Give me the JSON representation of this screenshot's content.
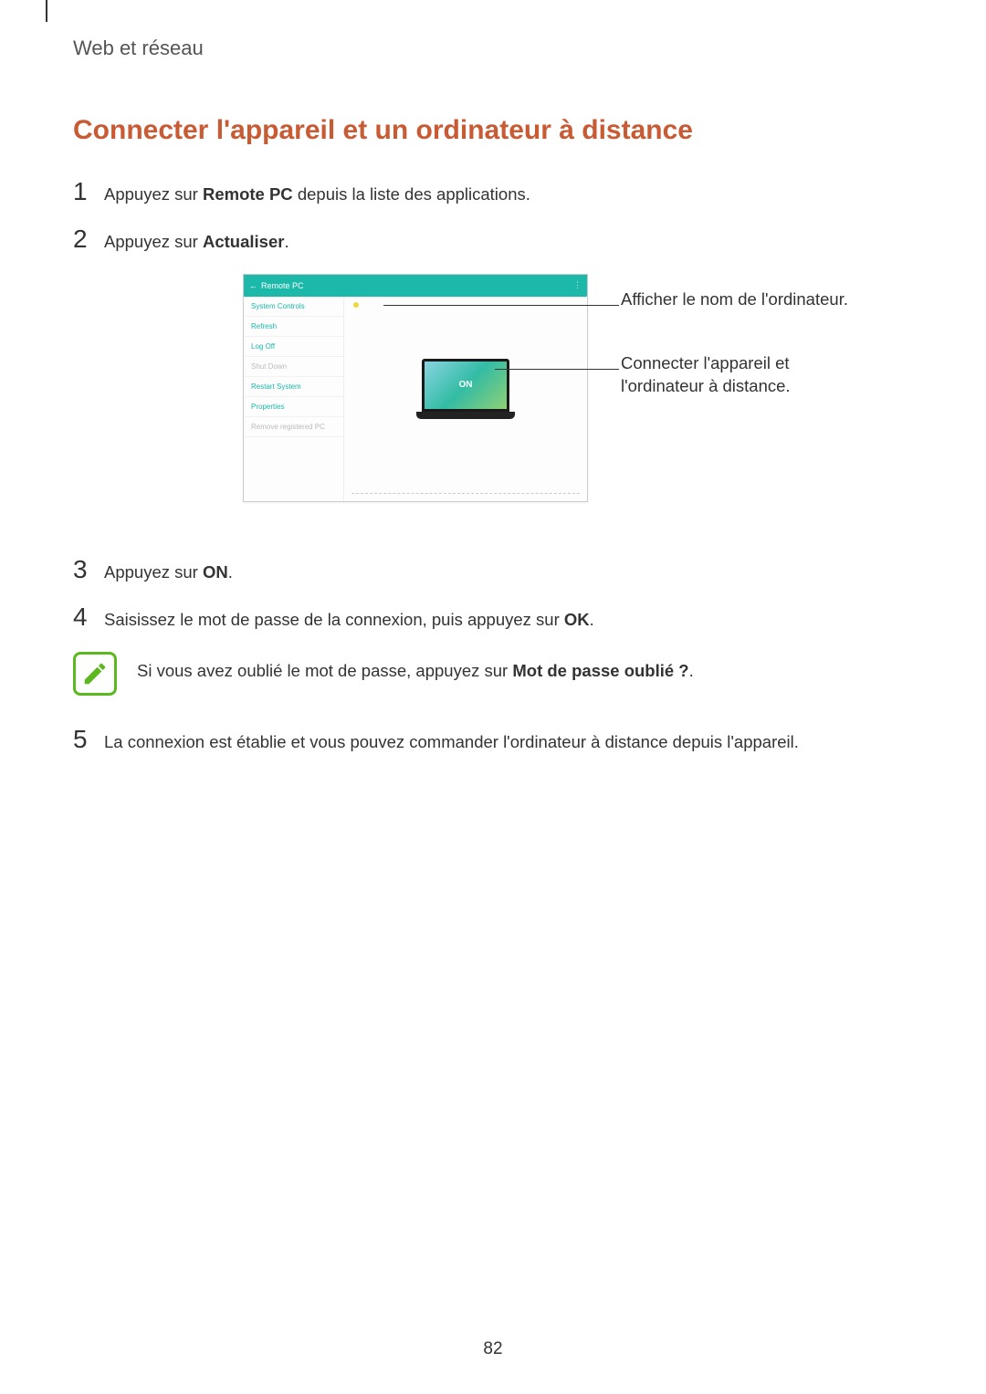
{
  "section_header": "Web et réseau",
  "title": "Connecter l'appareil et un ordinateur à distance",
  "steps": {
    "s1_pre": "Appuyez sur ",
    "s1_bold": "Remote PC",
    "s1_post": " depuis la liste des applications.",
    "s2_pre": "Appuyez sur ",
    "s2_bold": "Actualiser",
    "s2_post": ".",
    "s3_pre": "Appuyez sur ",
    "s3_bold": "ON",
    "s3_post": ".",
    "s4_pre": "Saisissez le mot de passe de la connexion, puis appuyez sur ",
    "s4_bold": "OK",
    "s4_post": ".",
    "s5": "La connexion est établie et vous pouvez commander l'ordinateur à distance depuis l'appareil."
  },
  "note": {
    "pre": "Si vous avez oublié le mot de passe, appuyez sur ",
    "bold": "Mot de passe oublié ?",
    "post": "."
  },
  "callouts": {
    "c1": "Afficher le nom de l'ordinateur.",
    "c2": "Connecter l'appareil et l'ordinateur à distance."
  },
  "screenshot": {
    "header_title": "Remote PC",
    "sidebar": {
      "item0": "System Controls",
      "item1": "Refresh",
      "item2": "Log Off",
      "item3": "Shut Down",
      "item4": "Restart System",
      "item5": "Properties",
      "item6": "Remove registered PC"
    },
    "pc_status_label": "",
    "laptop_label": "ON"
  },
  "page_number": "82"
}
